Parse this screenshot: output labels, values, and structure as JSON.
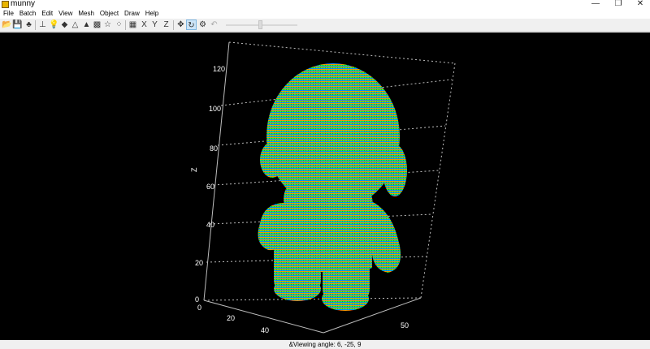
{
  "window": {
    "title": "munny",
    "minimize": "—",
    "restore": "❐",
    "close": "✕"
  },
  "menu": {
    "items": [
      "File",
      "Batch",
      "Edit",
      "View",
      "Mesh",
      "Object",
      "Draw",
      "Help"
    ]
  },
  "toolbar": {
    "icons": [
      "open-folder-icon",
      "save-icon",
      "people-icon",
      "axes-icon",
      "lightbulb-icon",
      "mesh-shaded-icon",
      "mesh-wire-icon",
      "rainbow-icon",
      "colormap-icon",
      "star-icon",
      "point-scatter-icon",
      "grid-icon",
      "x-axis-icon",
      "y-axis-icon",
      "z-axis-icon",
      "move-icon",
      "rotate-icon",
      "zoom-icon",
      "undo-icon"
    ],
    "active_tool": "rotate-icon"
  },
  "viewport": {
    "z_axis_label": "Z",
    "z_ticks": [
      "0",
      "20",
      "40",
      "60",
      "80",
      "100",
      "120"
    ],
    "x_ticks": [
      "0",
      "20",
      "40"
    ],
    "y_ticks": [
      "50"
    ],
    "colormap": [
      "#0000ff",
      "#00ffff",
      "#00ff00",
      "#ffff00",
      "#ff0000"
    ],
    "background": "#000000"
  },
  "status": {
    "text": "&Viewing angle: 6, -25, 9"
  }
}
